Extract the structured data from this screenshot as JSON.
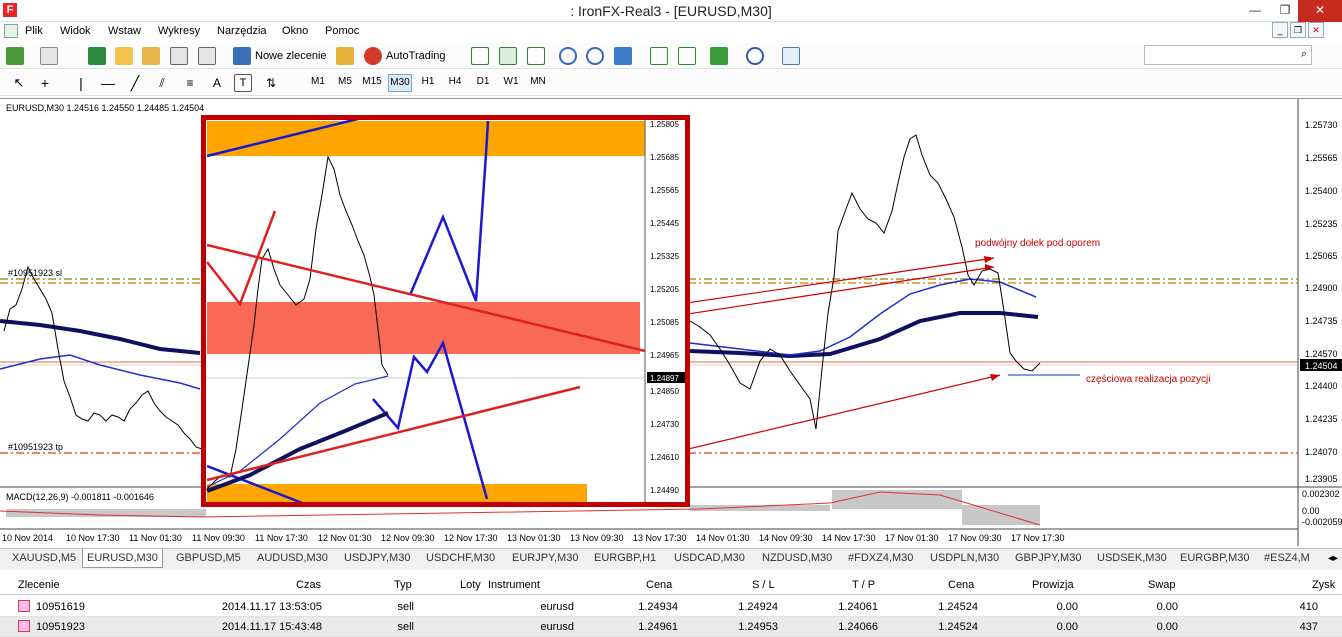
{
  "window": {
    "title": ": IronFX-Real3 - [EURUSD,M30]",
    "app_icon": "F"
  },
  "menu": [
    "Plik",
    "Widok",
    "Wstaw",
    "Wykresy",
    "Narzędzia",
    "Okno",
    "Pomoc"
  ],
  "toolbar": {
    "new_order": "Nowe zlecenie",
    "autotrading": "AutoTrading"
  },
  "timeframes": [
    "M1",
    "M5",
    "M15",
    "M30",
    "H1",
    "H4",
    "D1",
    "W1",
    "MN"
  ],
  "active_timeframe": "M30",
  "chart": {
    "header": "EURUSD,M30  1.24516 1.24550 1.24485 1.24504",
    "sl_label": "#10951923 sl",
    "tp_label": "#10951923 tp",
    "annotation_1": "podwójny dołek pod oporem",
    "annotation_2": "częściowa realizacja pozycji",
    "price_ticks": [
      "1.25730",
      "1.25565",
      "1.25400",
      "1.25235",
      "1.25065",
      "1.24900",
      "1.24735",
      "1.24570",
      "1.24400",
      "1.24235",
      "1.24070",
      "1.23905"
    ],
    "current_price": "1.24504",
    "inset_ticks": [
      "1.25805",
      "1.25685",
      "1.25565",
      "1.25445",
      "1.25325",
      "1.25205",
      "1.25085",
      "1.24965",
      "1.24850",
      "1.24730",
      "1.24610",
      "1.24490"
    ],
    "inset_price": "1.24897",
    "macd_label": "MACD(12,26,9) -0.001811 -0.001646",
    "macd_ticks": [
      "0.002302",
      "0.00",
      "-0.002059"
    ],
    "time_labels": [
      "10 Nov 2014",
      "10 Nov 17:30",
      "11 Nov 01:30",
      "11 Nov 09:30",
      "11 Nov 17:30",
      "12 Nov 01:30",
      "12 Nov 09:30",
      "12 Nov 17:30",
      "13 Nov 01:30",
      "13 Nov 09:30",
      "13 Nov 17:30",
      "14 Nov 01:30",
      "14 Nov 09:30",
      "14 Nov 17:30",
      "17 Nov 01:30",
      "17 Nov 09:30",
      "17 Nov 17:30"
    ],
    "colors": {
      "annotation": "#cc0000",
      "inset_border": "#c00000",
      "orange_zone": "#ffa500",
      "resistance_zone": "#f86a56",
      "trend_blue": "#1a1acc"
    }
  },
  "symbol_tabs": [
    "XAUUSD,M5",
    "EURUSD,M30",
    "GBPUSD,M5",
    "AUDUSD,M30",
    "USDJPY,M30",
    "USDCHF,M30",
    "EURJPY,M30",
    "EURGBP,H1",
    "USDCAD,M30",
    "NZDUSD,M30",
    "#FDXZ4,M30",
    "USDPLN,M30",
    "GBPJPY,M30",
    "USDSEK,M30",
    "EURGBP,M30",
    "#ESZ4,M"
  ],
  "active_symbol_tab": "EURUSD,M30",
  "orders": {
    "columns": [
      "Zlecenie",
      "Czas",
      "Typ",
      "Loty",
      "Instrument",
      "Cena",
      "S / L",
      "T / P",
      "Cena",
      "Prowizja",
      "Swap",
      "Zysk"
    ],
    "rows": [
      {
        "id": "10951619",
        "time": "2014.11.17 13:53:05",
        "type": "sell",
        "lots": "",
        "instrument": "eurusd",
        "price": "1.24934",
        "sl": "1.24924",
        "tp": "1.24061",
        "cur_price": "1.24524",
        "commission": "0.00",
        "swap": "0.00",
        "profit": "410"
      },
      {
        "id": "10951923",
        "time": "2014.11.17 15:43:48",
        "type": "sell",
        "lots": "",
        "instrument": "eurusd",
        "price": "1.24961",
        "sl": "1.24953",
        "tp": "1.24066",
        "cur_price": "1.24524",
        "commission": "0.00",
        "swap": "0.00",
        "profit": "437"
      }
    ]
  }
}
